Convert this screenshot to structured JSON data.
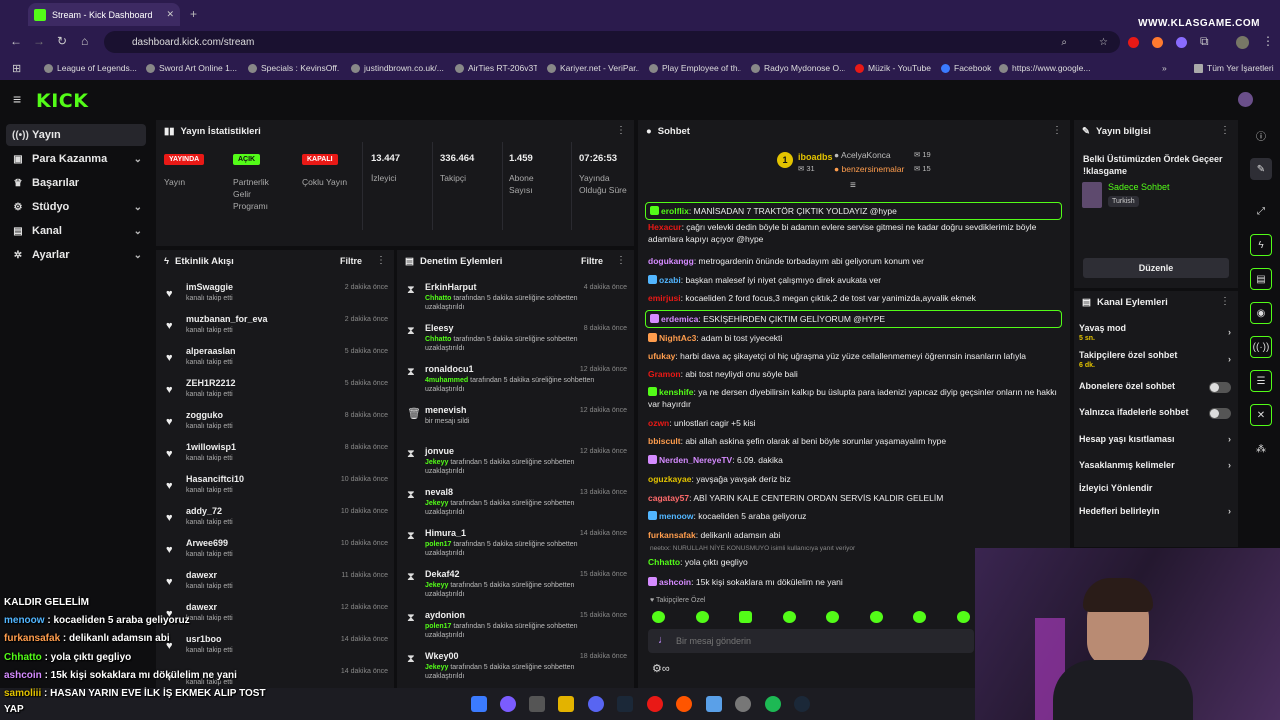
{
  "browser": {
    "tab_title": "Stream - Kick Dashboard",
    "url": "dashboard.kick.com/stream",
    "watermark": "WWW.KLASGAME.COM",
    "bookmarks": [
      "League of Legends...",
      "Sword Art Online 1...",
      "Specials : KevinsOff...",
      "justindbrown.co.uk/...",
      "AirTies RT-206v3TT",
      "Kariyer.net - VeriPar...",
      "Play Employee of th...",
      "Radyo Mydonose O...",
      "Müzik - YouTube",
      "Facebook",
      "https://www.google...",
      "Tüm Yer İşaretleri"
    ]
  },
  "header": {
    "logo": "KICK"
  },
  "sidebar": {
    "items": [
      {
        "label": "Yayın",
        "icon": "broadcast-icon",
        "active": true
      },
      {
        "label": "Para Kazanma",
        "icon": "money-icon",
        "chevron": true
      },
      {
        "label": "Başarılar",
        "icon": "trophy-icon"
      },
      {
        "label": "Stüdyo",
        "icon": "studio-icon",
        "chevron": true
      },
      {
        "label": "Kanal",
        "icon": "channel-icon",
        "chevron": true
      },
      {
        "label": "Ayarlar",
        "icon": "gear-icon",
        "chevron": true
      }
    ]
  },
  "stats": {
    "title": "Yayın İstatistikleri",
    "yayin_badge": "YAYINDA",
    "yayin_label": "Yayın",
    "partner_badge": "AÇIK",
    "partner_label": "Partnerlik Gelir Programı",
    "multi_badge": "KAPALI",
    "multi_label": "Çoklu Yayın",
    "viewers_value": "13.447",
    "viewers_label": "İzleyici",
    "followers_value": "336.464",
    "followers_label": "Takipçi",
    "subs_value": "1.459",
    "subs_label": "Abone Sayısı",
    "uptime_value": "07:26:53",
    "uptime_label": "Yayında Olduğu Süre",
    "colors": {
      "live": "#e91916",
      "on": "#53fc18",
      "off": "#e91916"
    }
  },
  "activity": {
    "title": "Etkinlik Akışı",
    "filter": "Filtre",
    "items": [
      {
        "name": "imSwaggie",
        "action": "kanalı takip etti",
        "time": "2 dakika önce"
      },
      {
        "name": "muzbanan_for_eva",
        "action": "kanalı takip etti",
        "time": "2 dakika önce"
      },
      {
        "name": "alperaaslan",
        "action": "kanalı takip etti",
        "time": "5 dakika önce"
      },
      {
        "name": "ZEH1R2212",
        "action": "kanalı takip etti",
        "time": "5 dakika önce"
      },
      {
        "name": "zogguko",
        "action": "kanalı takip etti",
        "time": "8 dakika önce"
      },
      {
        "name": "1willowisp1",
        "action": "kanalı takip etti",
        "time": "8 dakika önce"
      },
      {
        "name": "Hasanciftci10",
        "action": "kanalı takip etti",
        "time": "10 dakika önce"
      },
      {
        "name": "addy_72",
        "action": "kanalı takip etti",
        "time": "10 dakika önce"
      },
      {
        "name": "Arwee699",
        "action": "kanalı takip etti",
        "time": "10 dakika önce"
      },
      {
        "name": "dawexr",
        "action": "kanalı takip etti",
        "time": "11 dakika önce"
      },
      {
        "name": "dawexr",
        "action": "kanalı takip etti",
        "time": "12 dakika önce"
      },
      {
        "name": "usr1boo",
        "action": "kanalı takip etti",
        "time": "14 dakika önce"
      },
      {
        "name": "",
        "action": "kanalı takip etti",
        "time": "14 dakika önce"
      }
    ]
  },
  "moderation": {
    "title": "Denetim Eylemleri",
    "filter": "Filtre",
    "items": [
      {
        "name": "ErkinHarput",
        "mod": "Chhatto",
        "action": "tarafından 5 dakika süreliğine sohbetten uzaklaştırıldı",
        "time": "4 dakika önce",
        "icon": "hourglass-icon"
      },
      {
        "name": "Eleesy",
        "mod": "Chhatto",
        "action": "tarafından 5 dakika süreliğine sohbetten uzaklaştırıldı",
        "time": "8 dakika önce",
        "icon": "hourglass-icon"
      },
      {
        "name": "ronaldocu1",
        "mod": "4muhammed",
        "action": "tarafından 5 dakika süreliğine sohbetten uzaklaştırıldı",
        "time": "12 dakika önce",
        "icon": "hourglass-icon"
      },
      {
        "name": "menevish",
        "mod": "",
        "action": "bir mesajı sildi",
        "time": "12 dakika önce",
        "icon": "trash-icon"
      },
      {
        "name": "jonvue",
        "mod": "Jekeyy",
        "action": "tarafından 5 dakika süreliğine sohbetten uzaklaştırıldı",
        "time": "12 dakika önce",
        "icon": "hourglass-icon"
      },
      {
        "name": "neval8",
        "mod": "Jekeyy",
        "action": "tarafından 5 dakika süreliğine sohbetten uzaklaştırıldı",
        "time": "13 dakika önce",
        "icon": "hourglass-icon"
      },
      {
        "name": "Himura_1",
        "mod": "polen17",
        "action": "tarafından 5 dakika süreliğine sohbetten uzaklaştırıldı",
        "time": "14 dakika önce",
        "icon": "hourglass-icon"
      },
      {
        "name": "Dekaf42",
        "mod": "Jekeyy",
        "action": "tarafından 5 dakika süreliğine sohbetten uzaklaştırıldı",
        "time": "15 dakika önce",
        "icon": "hourglass-icon"
      },
      {
        "name": "aydonion",
        "mod": "polen17",
        "action": "tarafından 5 dakika süreliğine sohbetten uzaklaştırıldı",
        "time": "15 dakika önce",
        "icon": "hourglass-icon"
      },
      {
        "name": "Wkey00",
        "mod": "Jekeyy",
        "action": "tarafından 5 dakika süreliğine sohbetten uzaklaştırıldı",
        "time": "18 dakika önce",
        "icon": "hourglass-icon"
      }
    ]
  },
  "chat": {
    "title": "Sohbet",
    "leader1_name": "iboadbs",
    "leader1_count": "31",
    "leader2_name": "AcelyaKonca",
    "leader2_count": "19",
    "leader3_name": "benzersinemalar",
    "leader3_count": "15",
    "messages": [
      {
        "user": "erolflix",
        "text": "MANİSADAN 7 TRAKTÖR ÇIKTIK YOLDAYIZ @hype",
        "color": "#53fc18",
        "highlight": true
      },
      {
        "user": "Hexacur",
        "text": "çağrı velevki dedin böyle bi adamın evlere servise gitmesi ne kadar doğru sevdiklerimiz böyle adamlara kapıyı açıyor @hype",
        "color": "#e91916"
      },
      {
        "user": "dogukangg",
        "text": "metrogardenin önünde torbadayım abi geliyorum konum ver",
        "color": "#d58bff"
      },
      {
        "user": "ozabi",
        "text": "başkan malesef iyi niyet çalışmıyo direk avukata ver",
        "color": "#52b6ff"
      },
      {
        "user": "emirjusi",
        "text": "kocaeliden 2 ford focus,3 megan çıktık,2 de tost var yanimizda,ayvalik ekmek",
        "color": "#e91916"
      },
      {
        "user": "erdemica",
        "text": "ESKİŞEHİRDEN ÇIKTIM GELİYORUM @HYPE",
        "color": "#d58bff",
        "highlight": true
      },
      {
        "user": "NightAc3",
        "text": "adam bi tost yiyecekti",
        "color": "#ff9d4d"
      },
      {
        "user": "ufukay",
        "text": "harbi dava aç şikayetçi ol hiç uğraşma yüz yüze cellallenmemeyi öğrennsin insanların lafıyla",
        "color": "#ff9d4d"
      },
      {
        "user": "Gramon",
        "text": "abi tost neyliydi onu söyle bali",
        "color": "#e91916"
      },
      {
        "user": "kenshife",
        "text": "ya ne dersen diyebilirsin kalkıp bu üslupta para iadenizi yapıcaz diyip geçsinler onların ne hakkı var hayırdır",
        "color": "#53fc18"
      },
      {
        "user": "ozwn",
        "text": "unlostlari cagir +5 kisi",
        "color": "#e91916"
      },
      {
        "user": "bbiscult",
        "text": "abi allah askina şefin olarak al beni böyle sorunlar yaşamayalım hype",
        "color": "#ff9d4d"
      },
      {
        "user": "Nerden_NereyeTV",
        "text": "6.09. dakika",
        "color": "#d58bff"
      },
      {
        "user": "oguzkayae",
        "text": "yavşağa yavşak deriz biz",
        "color": "#e3c300"
      },
      {
        "user": "cagatay57",
        "text": "ABİ YARIN KALE CENTERIN ORDAN SERVİS KALDIR GELELİM",
        "color": "#ff6b6b"
      },
      {
        "user": "menoow",
        "text": "kocaeliden 5 araba geliyoruz",
        "color": "#52b6ff"
      },
      {
        "user": "furkansafak",
        "text": "delikanlı adamsın abi",
        "color": "#ff9d4d"
      },
      {
        "user": "Chhatto",
        "text": "yola çıktı gegliyo",
        "color": "#53fc18"
      },
      {
        "user": "ashcoin",
        "text": "15k kişi sokaklara mı dökülelim ne yani",
        "color": "#d58bff"
      }
    ],
    "reply_note": "neetxx: NURULLAH NİYE KONUSMUYO isimli kullanıcıya yanıt veriyor",
    "followers_only": "Takipçilere Özel",
    "input_placeholder": "Bir mesaj gönderin"
  },
  "stream_info": {
    "title": "Yayın bilgisi",
    "stream_title": "Belki Üstümüzden Ördek Geçeer !klasgame",
    "category": "Sadece Sohbet",
    "tag": "Turkish",
    "edit_button": "Düzenle"
  },
  "channel_actions": {
    "title": "Kanal Eylemleri",
    "slow_mode": "Yavaş mod",
    "slow_mode_value": "5 sn.",
    "followers_chat": "Takipçilere özel sohbet",
    "followers_chat_value": "6 dk.",
    "subs_chat": "Abonelere özel sohbet",
    "emote_chat": "Yalnızca ifadelerle sohbet",
    "age_restriction": "Hesap yaşı kısıtlaması",
    "banned_words": "Yasaklanmış kelimeler",
    "viewer_redirect": "İzleyici Yönlendir",
    "set_goals": "Hedefleri belirleyin"
  },
  "overlay": {
    "lines": [
      {
        "user": "",
        "text": "KALDIR GELELİM"
      },
      {
        "user": "menoow",
        "text": ": kocaeliden 5 araba geliyoruz"
      },
      {
        "user": "furkansafak",
        "text": ": delikanlı adamsın abi"
      },
      {
        "user": "Chhatto",
        "text": ": yola çıktı gegliyo"
      },
      {
        "user": "ashcoin",
        "text": ": 15k kişi sokaklara mı dökülelim ne yani"
      },
      {
        "user": "samoliii",
        "text": ": HASAN YARIN EVE İLK İŞ EKMEK ALIP TOST"
      },
      {
        "user": "",
        "text": "YAP"
      }
    ]
  }
}
